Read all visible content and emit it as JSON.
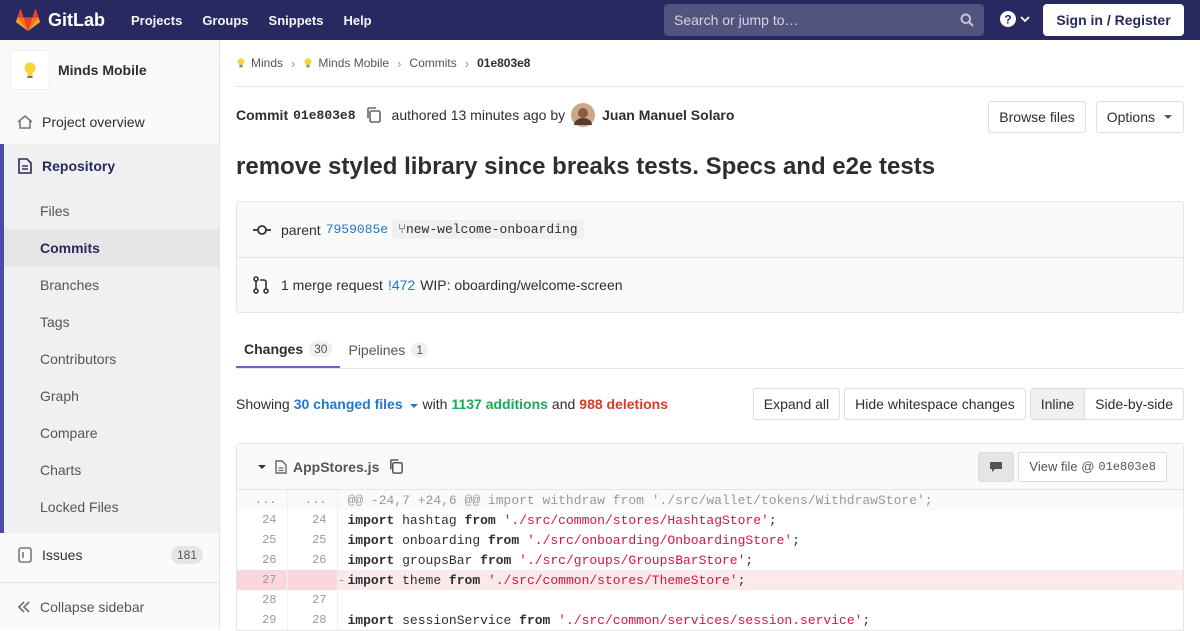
{
  "navbar": {
    "brand": "GitLab",
    "links": [
      "Projects",
      "Groups",
      "Snippets",
      "Help"
    ],
    "search_placeholder": "Search or jump to…",
    "signin": "Sign in / Register"
  },
  "sidebar": {
    "project_name": "Minds Mobile",
    "overview": "Project overview",
    "repository": "Repository",
    "sub_items": [
      "Files",
      "Commits",
      "Branches",
      "Tags",
      "Contributors",
      "Graph",
      "Compare",
      "Charts",
      "Locked Files"
    ],
    "issues": "Issues",
    "issues_count": "181",
    "collapse": "Collapse sidebar"
  },
  "breadcrumb": [
    "Minds",
    "Minds Mobile",
    "Commits",
    "01e803e8"
  ],
  "commit": {
    "label": "Commit",
    "sha": "01e803e8",
    "authored": "authored 13 minutes ago by",
    "author": "Juan Manuel Solaro",
    "browse_files": "Browse files",
    "options": "Options",
    "title": "remove styled library since breaks tests. Specs and e2e tests",
    "parent_label": "parent",
    "parent_sha": "7959085e",
    "branch": "new-welcome-onboarding",
    "mr_text": "1 merge request",
    "mr_id": "!472",
    "mr_title": "WIP: oboarding/welcome-screen"
  },
  "tabs": [
    {
      "label": "Changes",
      "count": "30"
    },
    {
      "label": "Pipelines",
      "count": "1"
    }
  ],
  "stats": {
    "showing": "Showing",
    "changed": "30 changed files",
    "with": "with",
    "additions": "1137 additions",
    "and": "and",
    "deletions": "988 deletions",
    "expand_all": "Expand all",
    "hide_whitespace": "Hide whitespace changes",
    "inline": "Inline",
    "side_by_side": "Side-by-side"
  },
  "file": {
    "name": "AppStores.js",
    "view_file": "View file @",
    "view_sha": "01e803e8",
    "lines": [
      {
        "old": "...",
        "new": "...",
        "type": "match",
        "marker": "",
        "text": "@@ -24,7 +24,6 @@ import withdraw from './src/wallet/tokens/WithdrawStore';"
      },
      {
        "old": "24",
        "new": "24",
        "type": "ctx",
        "marker": "",
        "kw1": "import",
        "id": "hashtag",
        "kw2": "from",
        "str": "'./src/common/stores/HashtagStore'",
        "end": ";"
      },
      {
        "old": "25",
        "new": "25",
        "type": "ctx",
        "marker": "",
        "kw1": "import",
        "id": "onboarding",
        "kw2": "from",
        "str": "'./src/onboarding/OnboardingStore'",
        "end": ";"
      },
      {
        "old": "26",
        "new": "26",
        "type": "ctx",
        "marker": "",
        "kw1": "import",
        "id": "groupsBar",
        "kw2": "from",
        "str": "'./src/groups/GroupsBarStore'",
        "end": ";"
      },
      {
        "old": "27",
        "new": "",
        "type": "old",
        "marker": "-",
        "kw1": "import",
        "id": "theme",
        "kw2": "from",
        "str": "'./src/common/stores/ThemeStore'",
        "end": ";"
      },
      {
        "old": "28",
        "new": "27",
        "type": "ctx",
        "marker": "",
        "kw1": "",
        "id": "",
        "kw2": "",
        "str": "",
        "end": ""
      },
      {
        "old": "29",
        "new": "28",
        "type": "ctx",
        "marker": "",
        "kw1": "import",
        "id": "sessionService",
        "kw2": "from",
        "str": "'./src/common/services/session.service'",
        "end": ";"
      }
    ]
  }
}
